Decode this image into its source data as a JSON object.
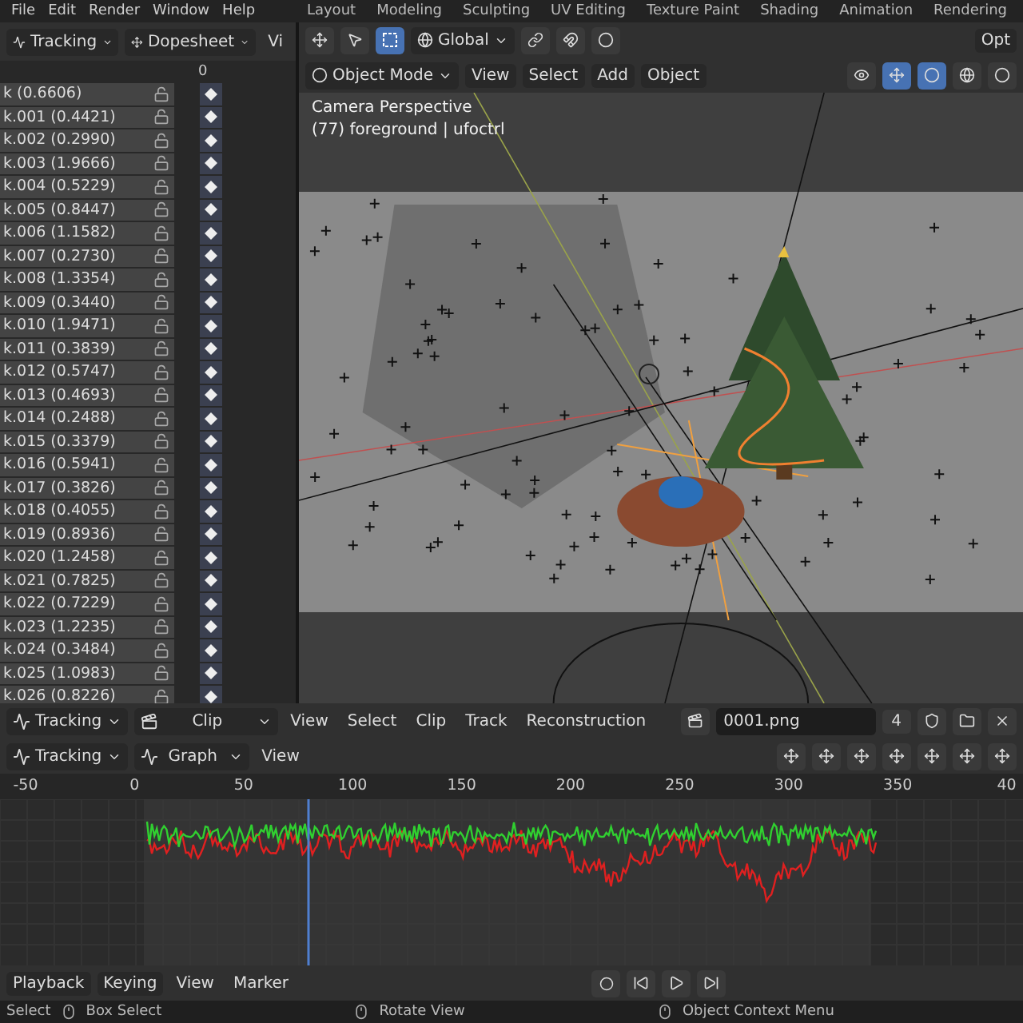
{
  "top_menu": [
    "File",
    "Edit",
    "Render",
    "Window",
    "Help"
  ],
  "workspace_tabs": [
    {
      "label": "Layout",
      "selected": false
    },
    {
      "label": "Modeling",
      "selected": false
    },
    {
      "label": "Sculpting",
      "selected": false
    },
    {
      "label": "UV Editing",
      "selected": false
    },
    {
      "label": "Texture Paint",
      "selected": false
    },
    {
      "label": "Shading",
      "selected": false
    },
    {
      "label": "Animation",
      "selected": false
    },
    {
      "label": "Rendering",
      "selected": false
    }
  ],
  "dopesheet": {
    "editor": "Tracking",
    "mode": "Dopesheet",
    "view_menu": "Vi",
    "frame_label": "0",
    "channels": [
      {
        "name": "k (0.6606)",
        "locked": false
      },
      {
        "name": "k.001 (0.4421)",
        "locked": false
      },
      {
        "name": "k.002 (0.2990)",
        "locked": false
      },
      {
        "name": "k.003 (1.9666)",
        "locked": false
      },
      {
        "name": "k.004 (0.5229)",
        "locked": false
      },
      {
        "name": "k.005 (0.8447)",
        "locked": false
      },
      {
        "name": "k.006 (1.1582)",
        "locked": false
      },
      {
        "name": "k.007 (0.2730)",
        "locked": false
      },
      {
        "name": "k.008 (1.3354)",
        "locked": false
      },
      {
        "name": "k.009 (0.3440)",
        "locked": false
      },
      {
        "name": "k.010 (1.9471)",
        "locked": false
      },
      {
        "name": "k.011 (0.3839)",
        "locked": false
      },
      {
        "name": "k.012 (0.5747)",
        "locked": false
      },
      {
        "name": "k.013 (0.4693)",
        "locked": false
      },
      {
        "name": "k.014 (0.2488)",
        "locked": false
      },
      {
        "name": "k.015 (0.3379)",
        "locked": false
      },
      {
        "name": "k.016 (0.5941)",
        "locked": false
      },
      {
        "name": "k.017 (0.3826)",
        "locked": false
      },
      {
        "name": "k.018 (0.4055)",
        "locked": false
      },
      {
        "name": "k.019 (0.8936)",
        "locked": false
      },
      {
        "name": "k.020 (1.2458)",
        "locked": false
      },
      {
        "name": "k.021 (0.7825)",
        "locked": false
      },
      {
        "name": "k.022 (0.7229)",
        "locked": false
      },
      {
        "name": "k.023 (1.2235)",
        "locked": false
      },
      {
        "name": "k.024 (0.3484)",
        "locked": false
      },
      {
        "name": "k.025 (1.0983)",
        "locked": false
      },
      {
        "name": "k.026 (0.8226)",
        "locked": false
      }
    ]
  },
  "viewport": {
    "orientation": "Global",
    "options": "Opt",
    "mode": "Object Mode",
    "menus": [
      "View",
      "Select",
      "Add",
      "Object"
    ],
    "overlay": [
      "Camera Perspective",
      "(77) foreground | ufoctrl"
    ]
  },
  "clip_header": {
    "editor": "Tracking",
    "mode": "Clip",
    "menus": [
      "View",
      "Select",
      "Clip",
      "Track",
      "Reconstruction"
    ],
    "clip_name": "0001.png",
    "users": "4"
  },
  "graph_header": {
    "editor": "Tracking",
    "mode": "Graph",
    "menus": [
      "View"
    ]
  },
  "graph": {
    "frame_ticks": [
      "-50",
      "0",
      "50",
      "100",
      "150",
      "200",
      "250",
      "300",
      "350",
      "40"
    ]
  },
  "timeline": {
    "menus": [
      "Playback",
      "Keying",
      "View",
      "Marker"
    ]
  },
  "status_bar": [
    "Select",
    "Box Select",
    "Rotate View",
    "Object Context Menu"
  ]
}
